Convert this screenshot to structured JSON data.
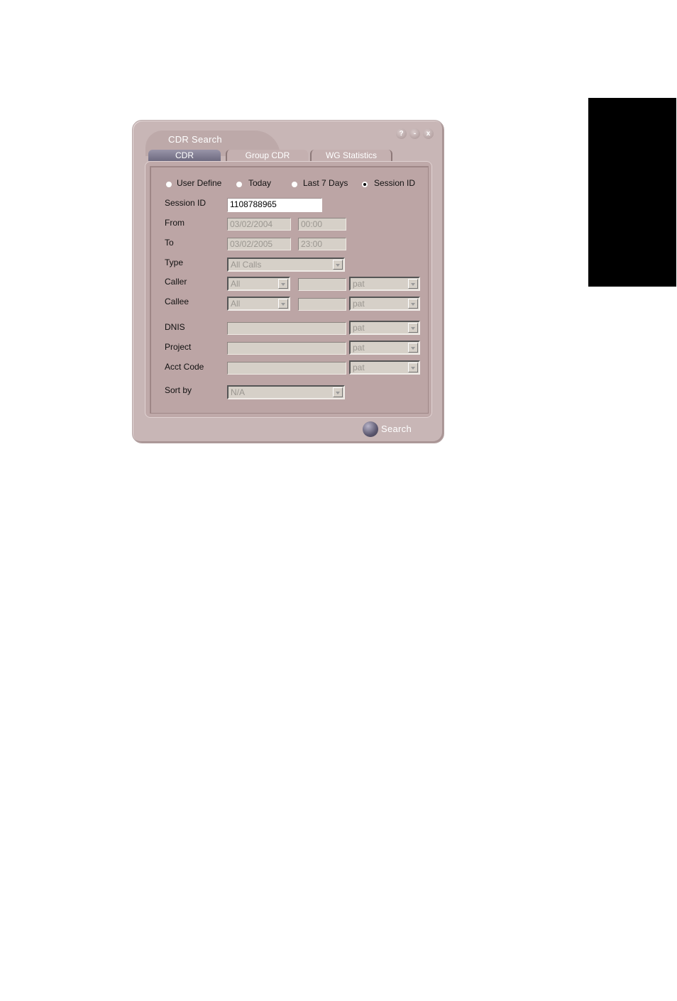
{
  "window": {
    "title": "CDR Search",
    "controls": {
      "help": "?",
      "minimize": "-",
      "close": "x"
    }
  },
  "tabs": [
    {
      "label": "CDR",
      "active": true
    },
    {
      "label": "Group CDR",
      "active": false
    },
    {
      "label": "WG Statistics",
      "active": false
    }
  ],
  "range_options": [
    {
      "label": "User Define",
      "selected": false
    },
    {
      "label": "Today",
      "selected": false
    },
    {
      "label": "Last 7 Days",
      "selected": false
    },
    {
      "label": "Session ID",
      "selected": true
    }
  ],
  "form": {
    "session_id": {
      "label": "Session ID",
      "value": "1108788965"
    },
    "from": {
      "label": "From",
      "date": "03/02/2004",
      "time": "00:00"
    },
    "to": {
      "label": "To",
      "date": "03/02/2005",
      "time": "23:00"
    },
    "type": {
      "label": "Type",
      "value": "All Calls"
    },
    "caller": {
      "label": "Caller",
      "mode": "All",
      "value": "",
      "user": "pat"
    },
    "callee": {
      "label": "Callee",
      "mode": "All",
      "value": "",
      "user": "pat"
    },
    "dnis": {
      "label": "DNIS",
      "value": "",
      "user": "pat"
    },
    "project": {
      "label": "Project",
      "value": "",
      "user": "pat"
    },
    "acct_code": {
      "label": "Acct Code",
      "value": "",
      "user": "pat"
    },
    "sort_by": {
      "label": "Sort by",
      "value": "N/A"
    }
  },
  "search_button": {
    "label": "Search"
  },
  "colors": {
    "window_bg": "#c8b6b6",
    "panel_bg": "#bca5a5",
    "active_tab": "#7e7a90",
    "side_tab": "#000000"
  }
}
